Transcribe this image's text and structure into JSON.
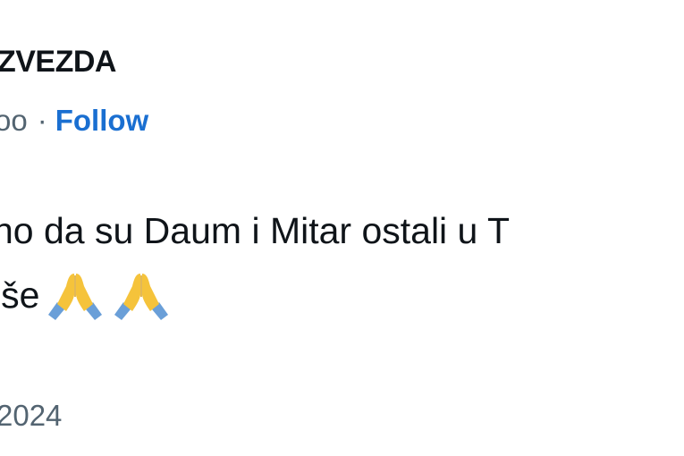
{
  "author": {
    "display_name": "iZVEZDA",
    "handle": "oo"
  },
  "meta": {
    "separator": "·",
    "follow_label": "Follow"
  },
  "tweet": {
    "line1": "no da su Daum i Mitar ostali u T",
    "line2": "iše",
    "emoji": [
      "folded-hands",
      "folded-hands"
    ]
  },
  "timestamp": {
    "year_text": "2024"
  },
  "colors": {
    "text": "#0f1419",
    "secondary": "#536471",
    "link": "#1a6fd1",
    "emoji_yellow": "#f5c33b",
    "emoji_sleeve": "#6a9fd8"
  }
}
